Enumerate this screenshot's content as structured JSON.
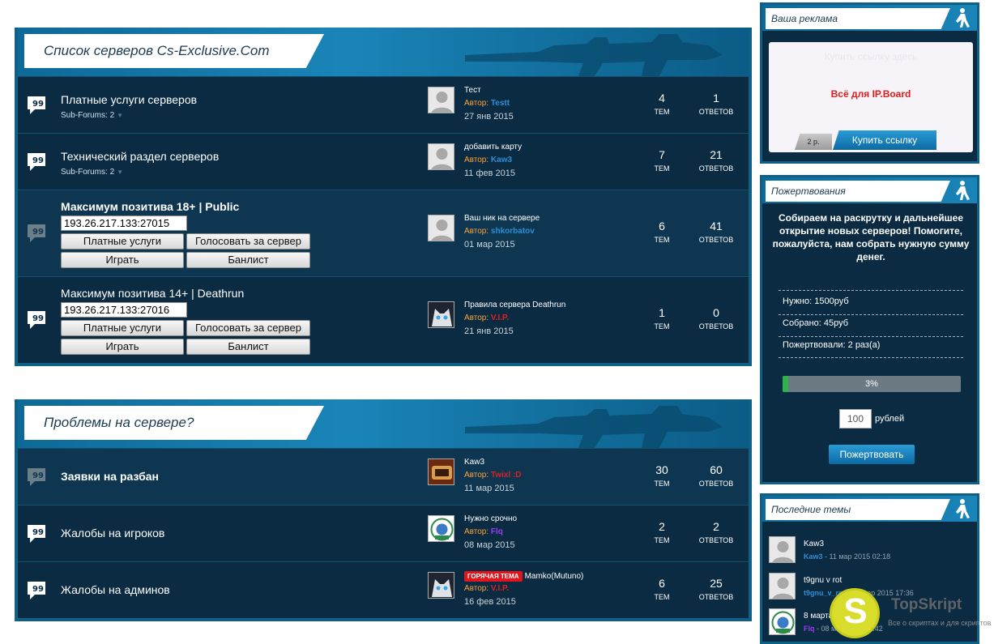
{
  "categories": [
    {
      "title": "Список серверов Cs-Exclusive.Com",
      "forums": [
        {
          "name": "Платные услуги серверов",
          "sub": "Sub-Forums: 2",
          "last_title": "Тест",
          "author_label": "Автор:",
          "author": "Testt",
          "author_color": "#2b8fd6",
          "date": "27 янв 2015",
          "topics": "4",
          "topics_label": "ТЕМ",
          "replies": "1",
          "replies_label": "ОТВЕТОВ"
        },
        {
          "name": "Технический раздел серверов",
          "sub": "Sub-Forums: 2",
          "last_title": "добавить карту",
          "author_label": "Автор:",
          "author": "Kaw3",
          "author_color": "#2b8fd6",
          "date": "11 фев 2015",
          "topics": "7",
          "topics_label": "ТЕМ",
          "replies": "21",
          "replies_label": "ОТВЕТОВ"
        },
        {
          "name": "Максимум позитива 18+ | Public",
          "ip": "193.26.217.133:27015",
          "btn_paid": "Платные услуги",
          "btn_vote": "Голосовать за сервер",
          "btn_play": "Играть",
          "btn_ban": "Банлист",
          "last_title": "Ваш ник на сервере",
          "author_label": "Автор:",
          "author": "shkorbatov",
          "author_color": "#2b8fd6",
          "date": "01 мар 2015",
          "topics": "6",
          "topics_label": "ТЕМ",
          "replies": "41",
          "replies_label": "ОТВЕТОВ"
        },
        {
          "name": "Максимум позитива 14+ | Deathrun",
          "ip": "193.26.217.133:27016",
          "btn_paid": "Платные услуги",
          "btn_vote": "Голосовать за сервер",
          "btn_play": "Играть",
          "btn_ban": "Банлист",
          "last_title": "Правила сервера Deathrun",
          "author_label": "Автор:",
          "author": "V.I.P.",
          "author_color": "#e02020",
          "date": "21 янв 2015",
          "topics": "1",
          "topics_label": "ТЕМ",
          "replies": "0",
          "replies_label": "ОТВЕТОВ"
        }
      ]
    },
    {
      "title": "Проблемы на сервере?",
      "forums": [
        {
          "name": "Заявки на разбан",
          "last_title": "Kaw3",
          "author_label": "Автор:",
          "author": "Twixl :D",
          "author_color": "#e02020",
          "date": "11 мар 2015",
          "topics": "30",
          "topics_label": "ТЕМ",
          "replies": "60",
          "replies_label": "ОТВЕТОВ"
        },
        {
          "name": "Жалобы на игроков",
          "last_title": "Нужно срочно",
          "author_label": "Автор:",
          "author": "Flq",
          "author_color": "#9b3cf0",
          "date": "08 мар 2015",
          "topics": "2",
          "topics_label": "ТЕМ",
          "replies": "2",
          "replies_label": "ОТВЕТОВ"
        },
        {
          "name": "Жалобы на админов",
          "hot_badge": "ГОРЯЧАЯ ТЕМА",
          "last_title": "Mamko(Mutuno)",
          "author_label": "Автор:",
          "author": "V.I.P.",
          "author_color": "#e02020",
          "date": "16 фев 2015",
          "topics": "6",
          "topics_label": "ТЕМ",
          "replies": "25",
          "replies_label": "ОТВЕТОВ"
        }
      ]
    }
  ],
  "sidebar": {
    "ads": {
      "title": "Ваша реклама",
      "ghost_text": "Купить ссылку здесь",
      "ad_text": "Всё для IP.Board",
      "price": "2 р.",
      "buy_label": "Купить ссылку"
    },
    "donations": {
      "title": "Пожертвования",
      "text": "Собираем на раскрутку и дальнейшее открытие новых серверов! Помогите, пожалуйста, нам собрать нужную сумму денег.",
      "needed": "Нужно: 1500руб",
      "collected": "Собрано: 45руб",
      "donors": "Пожертвовали: 2 раз(а)",
      "progress_label": "3%",
      "progress_value": 0.03,
      "amount": "100",
      "unit": "рублей",
      "button": "Пожертвовать"
    },
    "latest": {
      "title": "Последние темы",
      "items": [
        {
          "title": "Kaw3",
          "author": "Kaw3",
          "meta": " - 11 мар 2015 02:18"
        },
        {
          "title": "t9gnu v rot",
          "author": "t9gnu_v_rot",
          "meta": " - 10 мар 2015 17:36"
        },
        {
          "title": "8 марта",
          "author": "Flq",
          "meta": " - 08 мар 2015 22:42"
        }
      ]
    }
  },
  "watermark": {
    "letter": "S",
    "brand": "TopSkript",
    "slogan": "Все о скриптах и для скриптов"
  },
  "colors": {
    "accent_blue": "#0f5f86",
    "row_bg": "#0b2b42",
    "progress": "#2eb34b",
    "hot_badge": "#e0141d"
  }
}
